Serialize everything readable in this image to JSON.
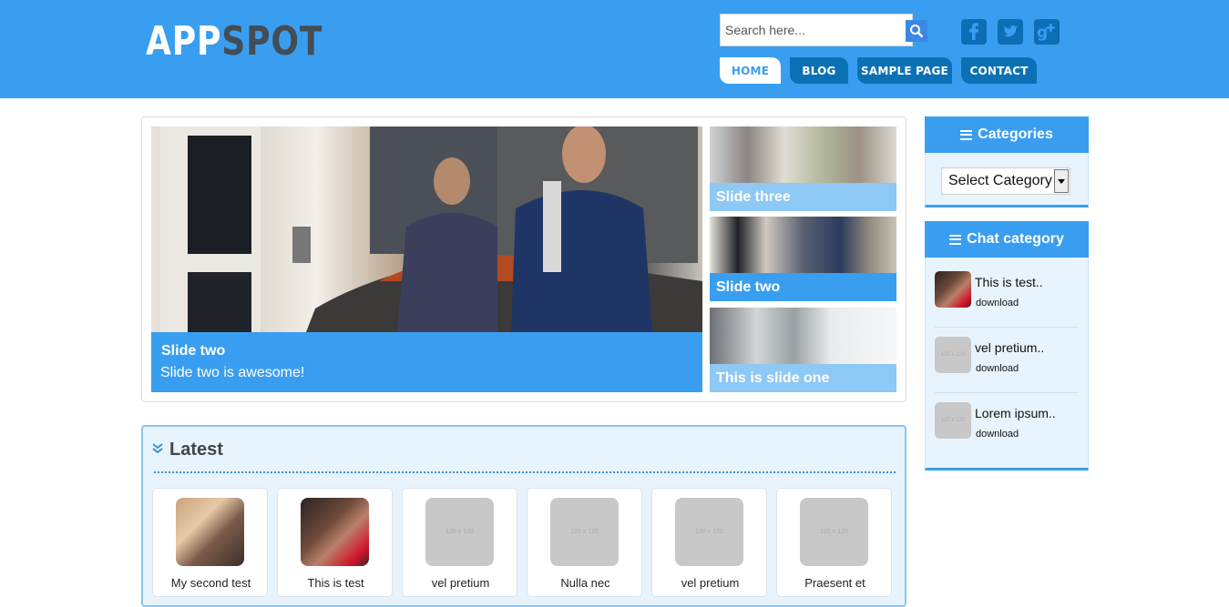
{
  "header": {
    "logo_part1": "APP",
    "logo_part2": "SPOT",
    "search_placeholder": "Search here...",
    "social": [
      "facebook-icon",
      "twitter-icon",
      "google-plus-icon"
    ],
    "nav": [
      "HOME",
      "BLOG",
      "SAMPLE PAGE",
      "CONTACT"
    ]
  },
  "slider": {
    "main_title": "Slide two",
    "main_desc": "Slide two is awesome!",
    "thumbs": [
      "Slide three",
      "Slide two",
      "This is slide one"
    ]
  },
  "latest": {
    "title": "Latest",
    "placeholder_text": "120 x 120",
    "cards": [
      "My second test",
      "This is test",
      "vel pretium",
      "Nulla nec",
      "vel pretium",
      "Praesent et"
    ]
  },
  "sidebar": {
    "categories_title": "Categories",
    "select_value": "Select Category",
    "chat_title": "Chat category",
    "placeholder_text": "120 x 120",
    "chat_items": [
      {
        "name": "This is test..",
        "link": "download"
      },
      {
        "name": "vel pretium..",
        "link": "download"
      },
      {
        "name": "Lorem ipsum..",
        "link": "download"
      }
    ]
  },
  "colors": {
    "brand": "#3a9ef0",
    "nav_dark": "#0b71b4",
    "panel_bg": "#e8f4fd"
  }
}
